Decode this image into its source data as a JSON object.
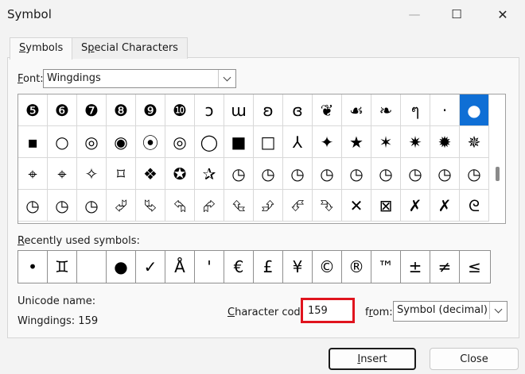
{
  "window": {
    "title": "Symbol",
    "minimize": "—",
    "maximize": "☐",
    "close": "✕"
  },
  "tabs": [
    {
      "label": "Symbols"
    },
    {
      "label": "Special Characters"
    }
  ],
  "font": {
    "label": "Font:",
    "value": "Wingdings"
  },
  "symbol_grid": {
    "rows": [
      [
        "❺",
        "❻",
        "❼",
        "❽",
        "❾",
        "❿",
        "ↄ",
        "ɯ",
        "ʚ",
        "ɞ",
        "❦",
        "☙",
        "❧",
        "ๆ",
        "·",
        "●"
      ],
      [
        "▪",
        "○",
        "◎",
        "◉",
        "⦿",
        "◎",
        "◯",
        "■",
        "□",
        "⅄",
        "✦",
        "★",
        "✶",
        "✷",
        "✹",
        "✵"
      ],
      [
        "⌖",
        "⌖",
        "✧",
        "⌑",
        "❖",
        "✪",
        "✰",
        "◷",
        "◷",
        "◷",
        "◷",
        "◷",
        "◷",
        "◷",
        "◷",
        "◷"
      ],
      [
        "◷",
        "◷",
        "◷",
        "⮰",
        "⮱",
        "⮲",
        "⮳",
        "⮴",
        "⮵",
        "⮶",
        "⮷",
        "✕",
        "⊠",
        "✗",
        "✗",
        "ᘓ"
      ]
    ],
    "selected_row": 0,
    "selected_col": 15
  },
  "recent": {
    "label": "Recently used symbols:",
    "symbols": [
      "•",
      "♊",
      "",
      "●",
      "✓",
      "Å",
      "'",
      "€",
      "£",
      "¥",
      "©",
      "®",
      "™",
      "±",
      "≠",
      "≤"
    ]
  },
  "unicode_name": {
    "label": "Unicode name:",
    "value": "Wingdings: 159"
  },
  "character_code": {
    "label": "Character code:",
    "value": "159"
  },
  "from": {
    "label": "from:",
    "value": "Symbol (decimal)"
  },
  "buttons": {
    "insert": "Insert",
    "close": "Close"
  }
}
